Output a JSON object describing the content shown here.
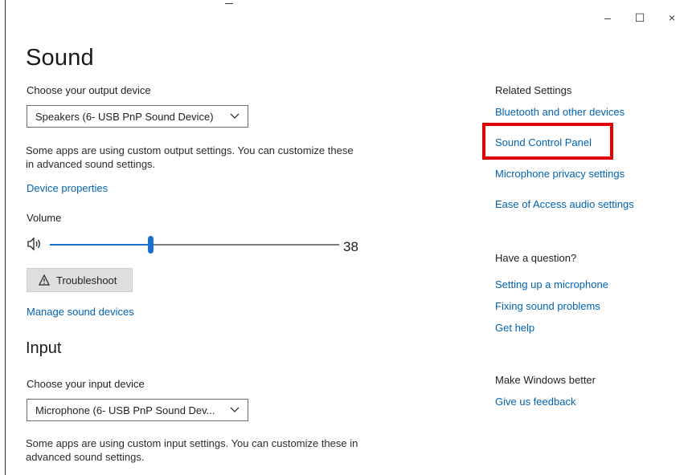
{
  "window": {
    "controls": {
      "minimize": "–",
      "maximize": "☐",
      "close": "×"
    }
  },
  "page": {
    "title": "Sound"
  },
  "output": {
    "choose_label": "Choose your output device",
    "device_value": "Speakers (6- USB PnP Sound Device)",
    "description_line1": "Some apps are using custom output settings. You can customize these",
    "description_line2": "in advanced sound settings.",
    "device_properties_link": "Device properties",
    "volume_label": "Volume",
    "volume_value": "38",
    "troubleshoot_label": "Troubleshoot",
    "manage_devices_link": "Manage sound devices"
  },
  "input": {
    "section_title": "Input",
    "choose_label": "Choose your input device",
    "device_value": "Microphone (6- USB PnP Sound Dev...",
    "description_line1": "Some apps are using custom input settings. You can customize these in",
    "description_line2": "advanced sound settings."
  },
  "related": {
    "title": "Related Settings",
    "links": [
      "Bluetooth and other devices",
      "Sound Control Panel",
      "Microphone privacy settings",
      "Ease of Access audio settings"
    ]
  },
  "question": {
    "title": "Have a question?",
    "links": [
      "Setting up a microphone",
      "Fixing sound problems",
      "Get help"
    ]
  },
  "feedback": {
    "title": "Make Windows better",
    "link": "Give us feedback"
  },
  "colors": {
    "link": "#0063b1",
    "accent": "#1a6fd1",
    "highlight": "#e00000"
  }
}
